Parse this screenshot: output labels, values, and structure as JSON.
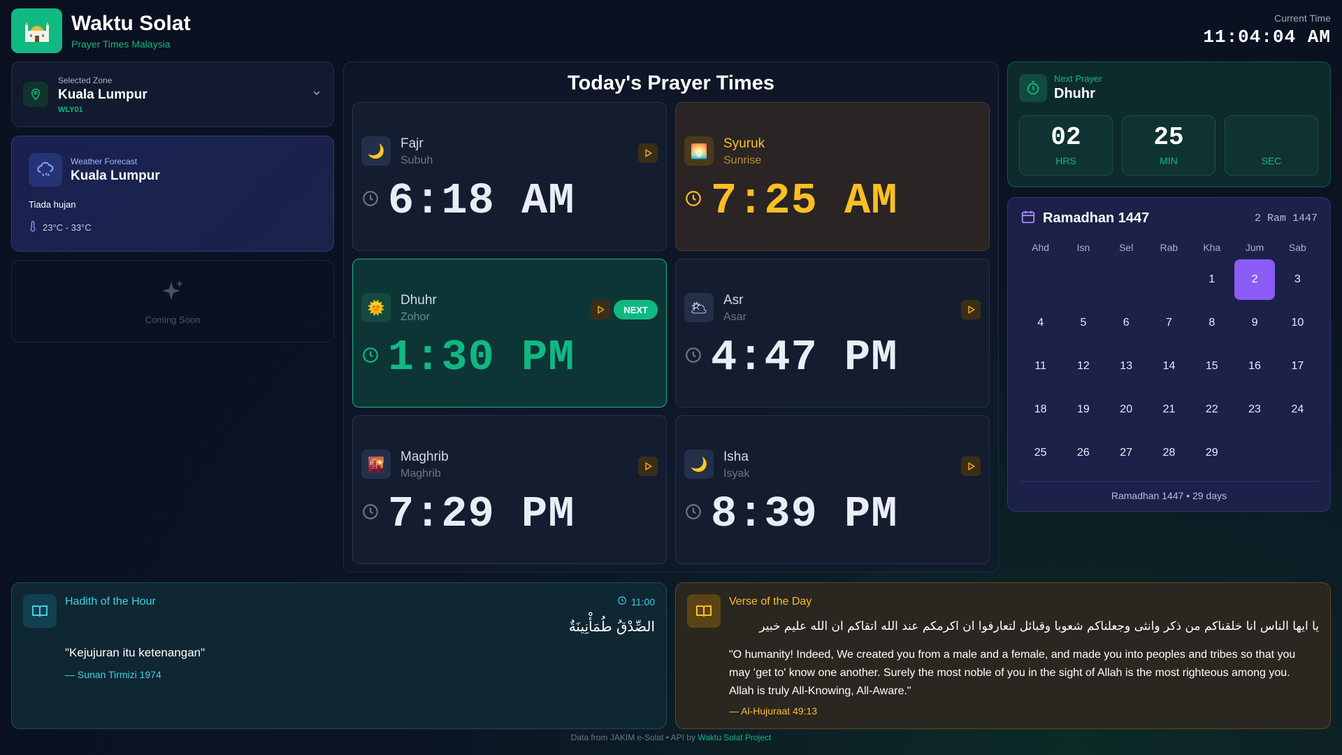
{
  "header": {
    "title": "Waktu Solat",
    "subtitle": "Prayer Times Malaysia",
    "current_time_label": "Current Time",
    "current_time": "11:04:04 AM"
  },
  "zone": {
    "label": "Selected Zone",
    "name": "Kuala Lumpur",
    "code": "WLY01"
  },
  "weather": {
    "label": "Weather Forecast",
    "city": "Kuala Lumpur",
    "condition": "Tiada hujan",
    "temperature": "23°C - 33°C"
  },
  "coming_soon": {
    "label": "Coming Soon"
  },
  "prayers": {
    "title": "Today's Prayer Times",
    "next_badge": "NEXT",
    "items": [
      {
        "name": "Fajr",
        "local": "Subuh",
        "time": "6:18 AM",
        "icon": "moon-icon"
      },
      {
        "name": "Syuruk",
        "local": "Sunrise",
        "time": "7:25 AM",
        "icon": "sunrise-icon"
      },
      {
        "name": "Dhuhr",
        "local": "Zohor",
        "time": "1:30 PM",
        "icon": "sun-icon"
      },
      {
        "name": "Asr",
        "local": "Asar",
        "time": "4:47 PM",
        "icon": "sun-cloud-icon"
      },
      {
        "name": "Maghrib",
        "local": "Maghrib",
        "time": "7:29 PM",
        "icon": "sunset-icon"
      },
      {
        "name": "Isha",
        "local": "Isyak",
        "time": "8:39 PM",
        "icon": "moon-icon"
      }
    ]
  },
  "countdown": {
    "label": "Next Prayer",
    "name": "Dhuhr",
    "hours": "02",
    "hours_unit": "HRS",
    "minutes": "25",
    "minutes_unit": "MIN",
    "seconds": "",
    "seconds_unit": "SEC"
  },
  "calendar": {
    "month": "Ramadhan 1447",
    "hijri_date": "2 Ram 1447",
    "weekdays": [
      "Ahd",
      "Isn",
      "Sel",
      "Rab",
      "Kha",
      "Jum",
      "Sab"
    ],
    "days": [
      "",
      "",
      "",
      "",
      "1",
      "2",
      "3",
      "4",
      "5",
      "6",
      "7",
      "8",
      "9",
      "10",
      "11",
      "12",
      "13",
      "14",
      "15",
      "16",
      "17",
      "18",
      "19",
      "20",
      "21",
      "22",
      "23",
      "24",
      "25",
      "26",
      "27",
      "28",
      "29"
    ],
    "today": "2",
    "footer": "Ramadhan 1447 • 29 days"
  },
  "hadith": {
    "title": "Hadith of the Hour",
    "time": "11:00",
    "arabic": "الصِّدْقُ طُمَأْنِينَةٌ",
    "text": "\"Kejujuran itu ketenangan\"",
    "source": "— Sunan Tirmizi 1974"
  },
  "verse": {
    "title": "Verse of the Day",
    "arabic": "يا ايها الناس انا خلقناكم من ذكر وانثى وجعلناكم شعوبا وقبائل لتعارفوا ان اكرمكم عند الله اتقاكم ان الله عليم خبير",
    "text": "\"O humanity! Indeed, We created you from a male and a female, and made you into peoples and tribes so that you may ʻget to' know one another. Surely the most noble of you in the sight of Allah is the most righteous among you. Allah is truly All-Knowing, All-Aware.\"",
    "source": "— Al-Hujuraat 49:13"
  },
  "footer": {
    "text": "Data from JAKIM e-Solat • API by",
    "link": "Waktu Solat Project"
  },
  "colors": {
    "accent": "#10b981",
    "sunrise": "#fbbf24",
    "today": "#8b5cf6",
    "hadith": "#3fd0e6"
  }
}
